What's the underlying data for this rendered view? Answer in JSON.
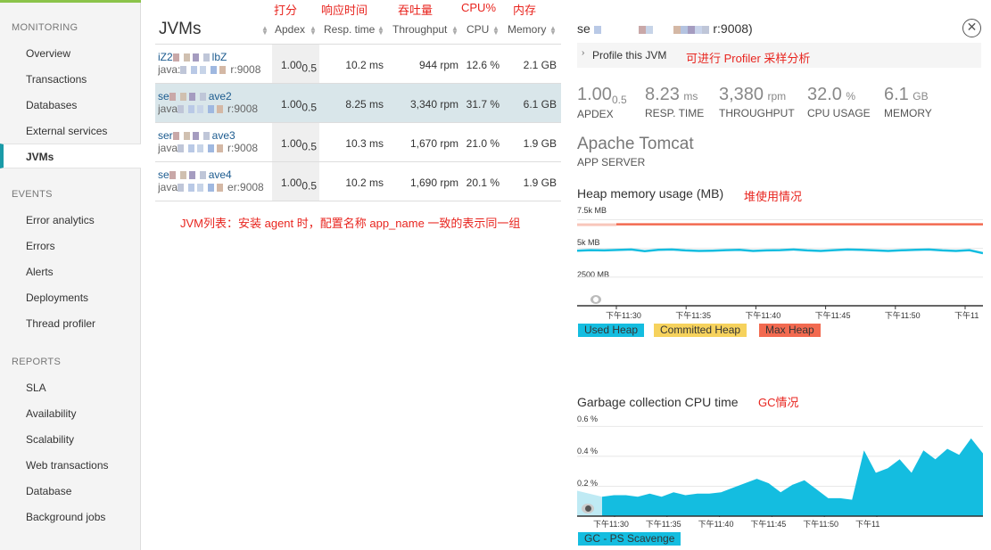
{
  "sidebar": {
    "monitoring_head": "MONITORING",
    "monitoring_items": [
      "Overview",
      "Transactions",
      "Databases",
      "External services",
      "JVMs"
    ],
    "events_head": "EVENTS",
    "events_items": [
      "Error analytics",
      "Errors",
      "Alerts",
      "Deployments",
      "Thread profiler"
    ],
    "reports_head": "REPORTS",
    "reports_items": [
      "SLA",
      "Availability",
      "Scalability",
      "Web transactions",
      "Database",
      "Background jobs"
    ],
    "active_item": "JVMs"
  },
  "table": {
    "title": "JVMs",
    "headers": [
      "Apdex",
      "Resp. time",
      "Throughput",
      "CPU",
      "Memory"
    ],
    "rows": [
      {
        "name1": "iZ2",
        "name1_tail": "lbZ",
        "name2": "java:",
        "name2_tail": "r:9008",
        "apdex": "1.00",
        "apdex_sub": "0.5",
        "resp": "10.2 ms",
        "throughput": "944 rpm",
        "cpu": "12.6 %",
        "memory": "2.1 GB"
      },
      {
        "name1": "se",
        "name1_tail": "ave2",
        "name2": "java",
        "name2_tail": "r:9008",
        "apdex": "1.00",
        "apdex_sub": "0.5",
        "resp": "8.25 ms",
        "throughput": "3,340 rpm",
        "cpu": "31.7 %",
        "memory": "6.1 GB"
      },
      {
        "name1": "ser",
        "name1_tail": "ave3",
        "name2": "java",
        "name2_tail": "r:9008",
        "apdex": "1.00",
        "apdex_sub": "0.5",
        "resp": "10.3 ms",
        "throughput": "1,670 rpm",
        "cpu": "21.0 %",
        "memory": "1.9 GB"
      },
      {
        "name1": "se",
        "name1_tail": "ave4",
        "name2": "java",
        "name2_tail": "er:9008",
        "apdex": "1.00",
        "apdex_sub": "0.5",
        "resp": "10.2 ms",
        "throughput": "1,690 rpm",
        "cpu": "20.1 %",
        "memory": "1.9 GB"
      }
    ],
    "selected_row": 1
  },
  "annotations": {
    "apdex": "打分",
    "resp": "响应时间",
    "throughput": "吞吐量",
    "cpu": "CPU%",
    "memory": "内存",
    "jvm_list": "JVM列表：安装 agent 时，配置名称 app_name 一致的表示同一组",
    "profiler": "可进行 Profiler 采样分析",
    "heap": "堆使用情况",
    "gc": "GC情况"
  },
  "detail": {
    "title_prefix": "se",
    "title_suffix": "r:9008)",
    "profile_label": "Profile this JVM",
    "summary": [
      {
        "value": "1.00",
        "sub": "0.5",
        "unit": "",
        "label": "APDEX"
      },
      {
        "value": "8.23",
        "sub": "",
        "unit": "ms",
        "label": "RESP. TIME"
      },
      {
        "value": "3,380",
        "sub": "",
        "unit": "rpm",
        "label": "THROUGHPUT"
      },
      {
        "value": "32.0",
        "sub": "",
        "unit": "%",
        "label": "CPU USAGE"
      },
      {
        "value": "6.1",
        "sub": "",
        "unit": "GB",
        "label": "MEMORY"
      }
    ],
    "app_name": "Apache Tomcat",
    "app_type": "APP SERVER"
  },
  "heap_chart": {
    "title": "Heap memory usage (MB)",
    "y_labels": [
      "7.5k MB",
      "5k MB",
      "2500 MB"
    ],
    "x_labels": [
      "下午11:30",
      "下午11:35",
      "下午11:40",
      "下午11:45",
      "下午11:50",
      "下午11"
    ],
    "legend": [
      {
        "name": "Used Heap",
        "color": "#14bde0"
      },
      {
        "name": "Committed Heap",
        "color": "#f6d25d"
      },
      {
        "name": "Max Heap",
        "color": "#f26a50"
      }
    ]
  },
  "gc_chart": {
    "title": "Garbage collection CPU time",
    "y_labels": [
      "0.6 %",
      "0.4 %",
      "0.2 %"
    ],
    "x_labels": [
      "下午11:30",
      "下午11:35",
      "下午11:40",
      "下午11:45",
      "下午11:50",
      "下午11"
    ],
    "legend": [
      {
        "name": "GC - PS Scavenge",
        "color": "#14bde0"
      }
    ]
  },
  "chart_data": [
    {
      "type": "line",
      "title": "Heap memory usage (MB)",
      "ylim": [
        0,
        8000
      ],
      "series": [
        {
          "name": "Used Heap",
          "values": [
            4800,
            4850,
            4820,
            4860,
            4900,
            4750,
            4880,
            4900,
            4820,
            4780,
            4800,
            4850,
            4870,
            4780,
            4820,
            4850,
            4900,
            4820,
            4780,
            4850,
            4900,
            4880,
            4820,
            4780,
            4830,
            4870,
            4900,
            4820,
            4780,
            4850,
            4580
          ]
        },
        {
          "name": "Max Heap",
          "values": [
            7100,
            7100,
            7100,
            7100,
            7100,
            7100,
            7100,
            7100,
            7100,
            7100,
            7100,
            7100,
            7100,
            7100,
            7100,
            7100,
            7100,
            7100,
            7100,
            7100,
            7100,
            7100,
            7100,
            7100,
            7100,
            7100,
            7100,
            7100,
            7100,
            7100,
            7100
          ]
        }
      ]
    },
    {
      "type": "area",
      "title": "Garbage collection CPU time",
      "ylim": [
        0,
        0.65
      ],
      "series": [
        {
          "name": "GC - PS Scavenge",
          "values": [
            0.13,
            0.14,
            0.14,
            0.13,
            0.15,
            0.13,
            0.16,
            0.14,
            0.15,
            0.15,
            0.16,
            0.19,
            0.22,
            0.25,
            0.22,
            0.16,
            0.21,
            0.24,
            0.18,
            0.12,
            0.12,
            0.11,
            0.44,
            0.29,
            0.32,
            0.38,
            0.29,
            0.44,
            0.38,
            0.45,
            0.41,
            0.52,
            0.42
          ]
        }
      ]
    }
  ]
}
